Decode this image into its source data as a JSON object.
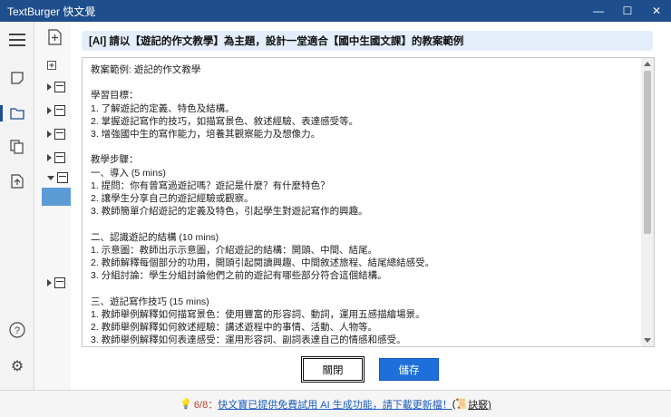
{
  "window": {
    "title": "TextBurger 快文覺",
    "controls": {
      "minimize": "—",
      "maximize": "☐",
      "close": "✕"
    }
  },
  "rail": {
    "icons": [
      "menu-icon",
      "note-icon",
      "folder-icon",
      "copy-icon",
      "export-icon",
      "help-icon",
      "settings-icon"
    ],
    "help_label": "?",
    "settings_label": "⚙"
  },
  "dialog": {
    "prompt": "[AI] 請以【遊記的作文教學】為主題，設計一堂適合【國中生國文課】的教案範例",
    "content": "教案範例: 遊記的作文教學\n\n學習目標：\n1. 了解遊記的定義、特色及結構。\n2. 掌握遊記寫作的技巧，如描寫景色、敘述經驗、表達感受等。\n3. 增強國中生的寫作能力，培養其觀察能力及想像力。\n\n教學步驟：\n一、導入 (5 mins)\n1. 提問：你有曾寫過遊記嗎？遊記是什麼？有什麼特色？\n2. 讓學生分享自己的遊記經驗或觀察。\n3. 教師簡單介紹遊記的定義及特色，引起學生對遊記寫作的興趣。\n\n二、認識遊記的結構 (10 mins)\n1. 示意圖：教師出示示意圖，介紹遊記的結構：開頭、中間、結尾。\n2. 教師解釋每個部分的功用，開頭引起閱讀興趣、中間敘述旅程、結尾總結感受。\n3. 分組討論：學生分組討論他們之前的遊記有哪些部分符合這個結構。\n\n三、遊記寫作技巧 (15 mins)\n1. 教師舉例解釋如何描寫景色：使用豐富的形容詞、動詞，運用五感描繪場景。\n2. 教師舉例解釋如何敘述經驗：講述遊程中的事情、活動、人物等。\n3. 教師舉例解釋如何表達感受：運用形容詞、副詞表達自己的情感和感受。",
    "close_label": "關閉",
    "save_label": "儲存"
  },
  "statusbar": {
    "bulb": "💡",
    "prefix": "6/8：",
    "link_text": "快文寶已提供免費試用 AI 生成功能，請下載更新檔！",
    "tip_icon": "(📜",
    "tip_label": "訣竅)"
  }
}
